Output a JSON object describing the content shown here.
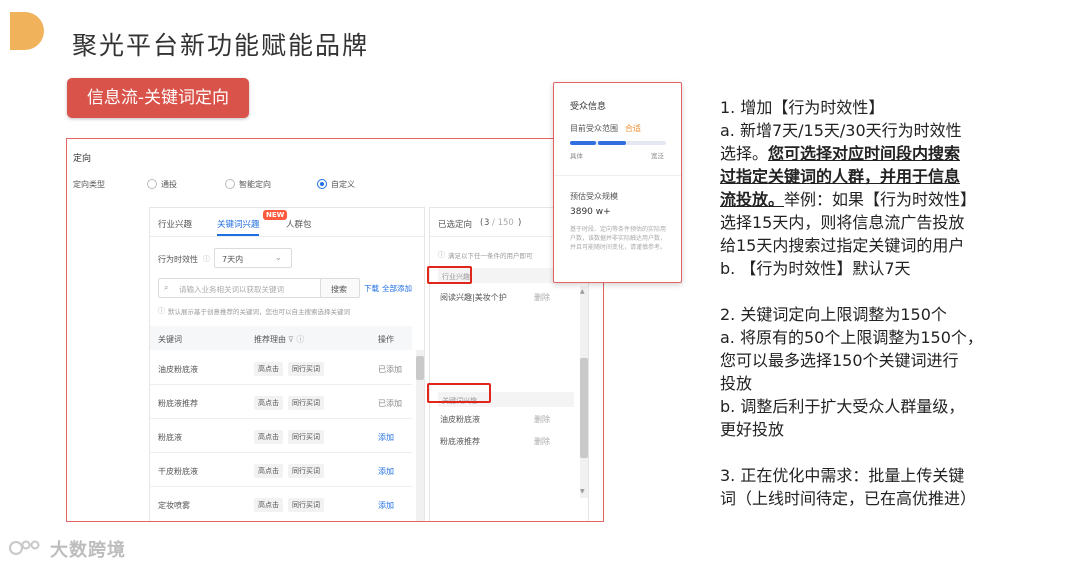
{
  "slide": {
    "title": "聚光平台新功能赋能品牌",
    "section_label": "信息流-关键词定向",
    "watermark": "大数跨境"
  },
  "targeting": {
    "section_title": "定向",
    "type_label": "定向类型",
    "options": [
      "通投",
      "智能定向",
      "自定义"
    ],
    "selected_option": "自定义",
    "tabs": [
      "行业兴趣",
      "关键词兴趣",
      "人群包"
    ],
    "active_tab": "关键词兴趣",
    "new_badge": "NEW",
    "effect_label": "行为时效性",
    "effect_value": "7天内",
    "search_placeholder": "请输入业务相关词以获取关键词",
    "search_button": "搜索",
    "download_link": "下载",
    "add_all_link": "全部添加",
    "hint": "默认展示基于创意推荐的关键词，您也可以自主搜索选择关键词",
    "table": {
      "headers": [
        "关键词",
        "推荐理由",
        "操作"
      ],
      "rows": [
        {
          "keyword": "油皮粉底液",
          "tags": [
            "高点击",
            "同行买词"
          ],
          "action": "已添加",
          "added": true
        },
        {
          "keyword": "粉底液推荐",
          "tags": [
            "高点击",
            "同行买词"
          ],
          "action": "已添加",
          "added": true
        },
        {
          "keyword": "粉底液",
          "tags": [
            "高点击",
            "同行买词"
          ],
          "action": "添加",
          "added": false
        },
        {
          "keyword": "干皮粉底液",
          "tags": [
            "高点击",
            "同行买词"
          ],
          "action": "添加",
          "added": false
        },
        {
          "keyword": "定妆喷雾",
          "tags": [
            "高点击",
            "同行买词"
          ],
          "action": "添加",
          "added": false
        }
      ]
    },
    "selected_panel": {
      "title": "已选定向",
      "count_selected": "3",
      "count_total": "/ 150",
      "hint": "满足以下任一条件的用户即可",
      "groups": [
        {
          "name": "行业兴趣",
          "items": [
            {
              "label": "阅读兴趣|美妆个护",
              "action": "删除"
            }
          ]
        },
        {
          "name": "关键词兴趣",
          "items": [
            {
              "label": "油皮粉底液",
              "action": "删除"
            },
            {
              "label": "粉底液推荐",
              "action": "删除"
            }
          ]
        }
      ]
    }
  },
  "audience": {
    "title": "受众信息",
    "range_label": "目前受众范围",
    "range_status": "合适",
    "scale_left": "具体",
    "scale_right": "宽泛",
    "estimate_label": "预估受众规模",
    "estimate_value": "3890 w+",
    "note": "基于时段、定向等条件预估的实际用户数，该数据并非实际触达用户数，并且可能随时间变化，请谨慎参考。",
    "level": 0.58
  },
  "notes": {
    "p1_title": "1. 增加【行为时效性】",
    "p1_a_lines": [
      "a. 新增7天/15天/30天行为时效性",
      "选择。"
    ],
    "p1_bold_lines": [
      "您可选择对应时间段内搜索",
      "过指定关键词的人群，并用于信息",
      "流投放。"
    ],
    "p1_tail": "举例：如果【行为时效性】",
    "p1_more_lines": [
      "选择15天内，则将信息流广告投放",
      "给15天内搜索过指定关键词的用户"
    ],
    "p1_b": "b. 【行为时效性】默认7天",
    "p2_title": "2. 关键词定向上限调整为150个",
    "p2_lines": [
      "a. 将原有的50个上限调整为150个，",
      "您可以最多选择150个关键词进行",
      "投放",
      "b. 调整后利于扩大受众人群量级，",
      "更好投放"
    ],
    "p3_lines": [
      "3. 正在优化中需求：批量上传关键",
      "词（上线时间待定，已在高优推进）"
    ]
  },
  "colors": {
    "accent_red": "#d9534a",
    "brand_blue": "#1f6fe0",
    "logo_orange": "#f0b35c",
    "status_orange": "#f08c2e"
  }
}
